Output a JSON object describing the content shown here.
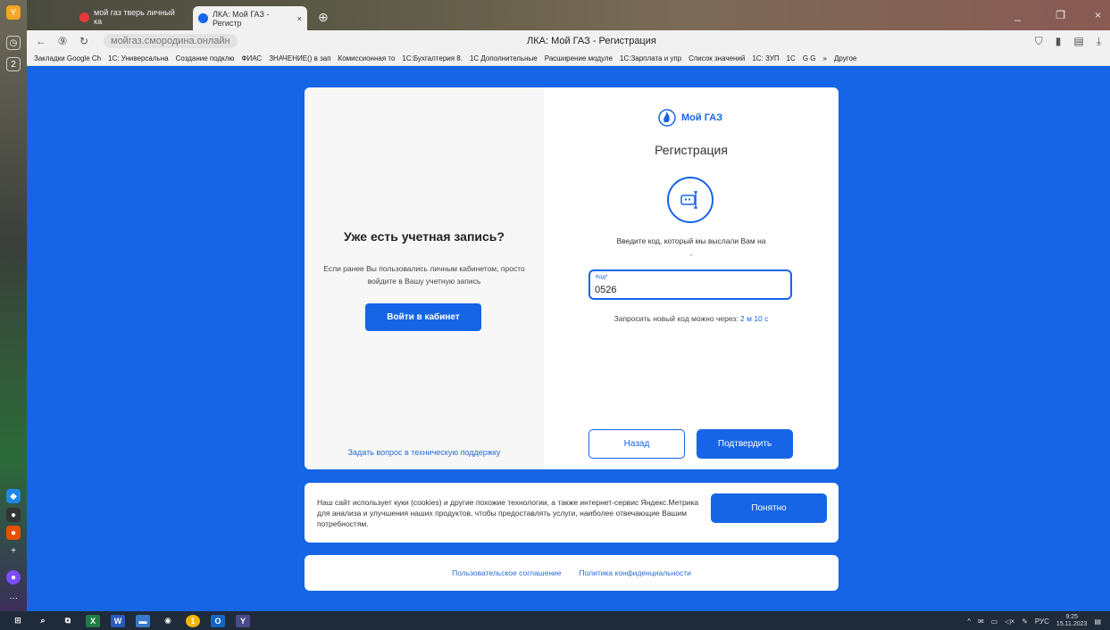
{
  "browser": {
    "tabs": [
      {
        "label": "мой газ тверь личный ка",
        "favicon_color": "#e53935"
      },
      {
        "label": "ЛКА: Мой ГАЗ - Регистр",
        "favicon_color": "#1565e6"
      }
    ],
    "url": "мойгаз.смородина.онлайн",
    "page_title": "ЛКА: Мой ГАЗ - Регистрация",
    "bookmarks": [
      "Закладки Google Ch",
      "1С: Универсальна",
      "Создание подклю",
      "ФИАС",
      "ЗНАЧЕНИЕ() в зап",
      "Комиссионная то",
      "1С:Бухгалтерия 8.",
      "1С Дополнительные",
      "Расширение модуле",
      "1С:Зарплата и упр",
      "Список значений",
      "1С: ЗУП",
      "1С",
      "G G",
      "»",
      "Другое"
    ]
  },
  "login_panel": {
    "title": "Уже есть учетная запись?",
    "description": "Если ранее Вы пользовались личным кабинетом, просто войдите в Вашу учетную запись",
    "login_button": "Войти в кабинет",
    "support_link": "Задать вопрос в техническую поддержку"
  },
  "register_panel": {
    "brand": "Мой ГАЗ",
    "title": "Регистрация",
    "hint": "Введите код, который мы выслали Вам на",
    "dash": "-",
    "code_label": "Код*",
    "code_value": "0526",
    "resend_text": "Запросить новый код можно через:",
    "resend_timer": "2 м 10 с",
    "back_button": "Назад",
    "confirm_button": "Подтвердить"
  },
  "cookie_banner": {
    "text": "Наш сайт использует куки (cookies) и другие похожие технологии, а также интернет-сервис Яндекс.Метрика для анализа и улучшения наших продуктов, чтобы предоставлять услуги, наиболее отвечающие Вашим потребностям.",
    "ok_button": "Понятно"
  },
  "footer": {
    "links": [
      "Пользовательское соглашение",
      "Политика конфиденциальности"
    ]
  },
  "taskbar": {
    "lang": "РУС",
    "time": "9:25",
    "date": "15.11.2023"
  },
  "colors": {
    "accent": "#1565e6",
    "background": "#1565e6"
  }
}
